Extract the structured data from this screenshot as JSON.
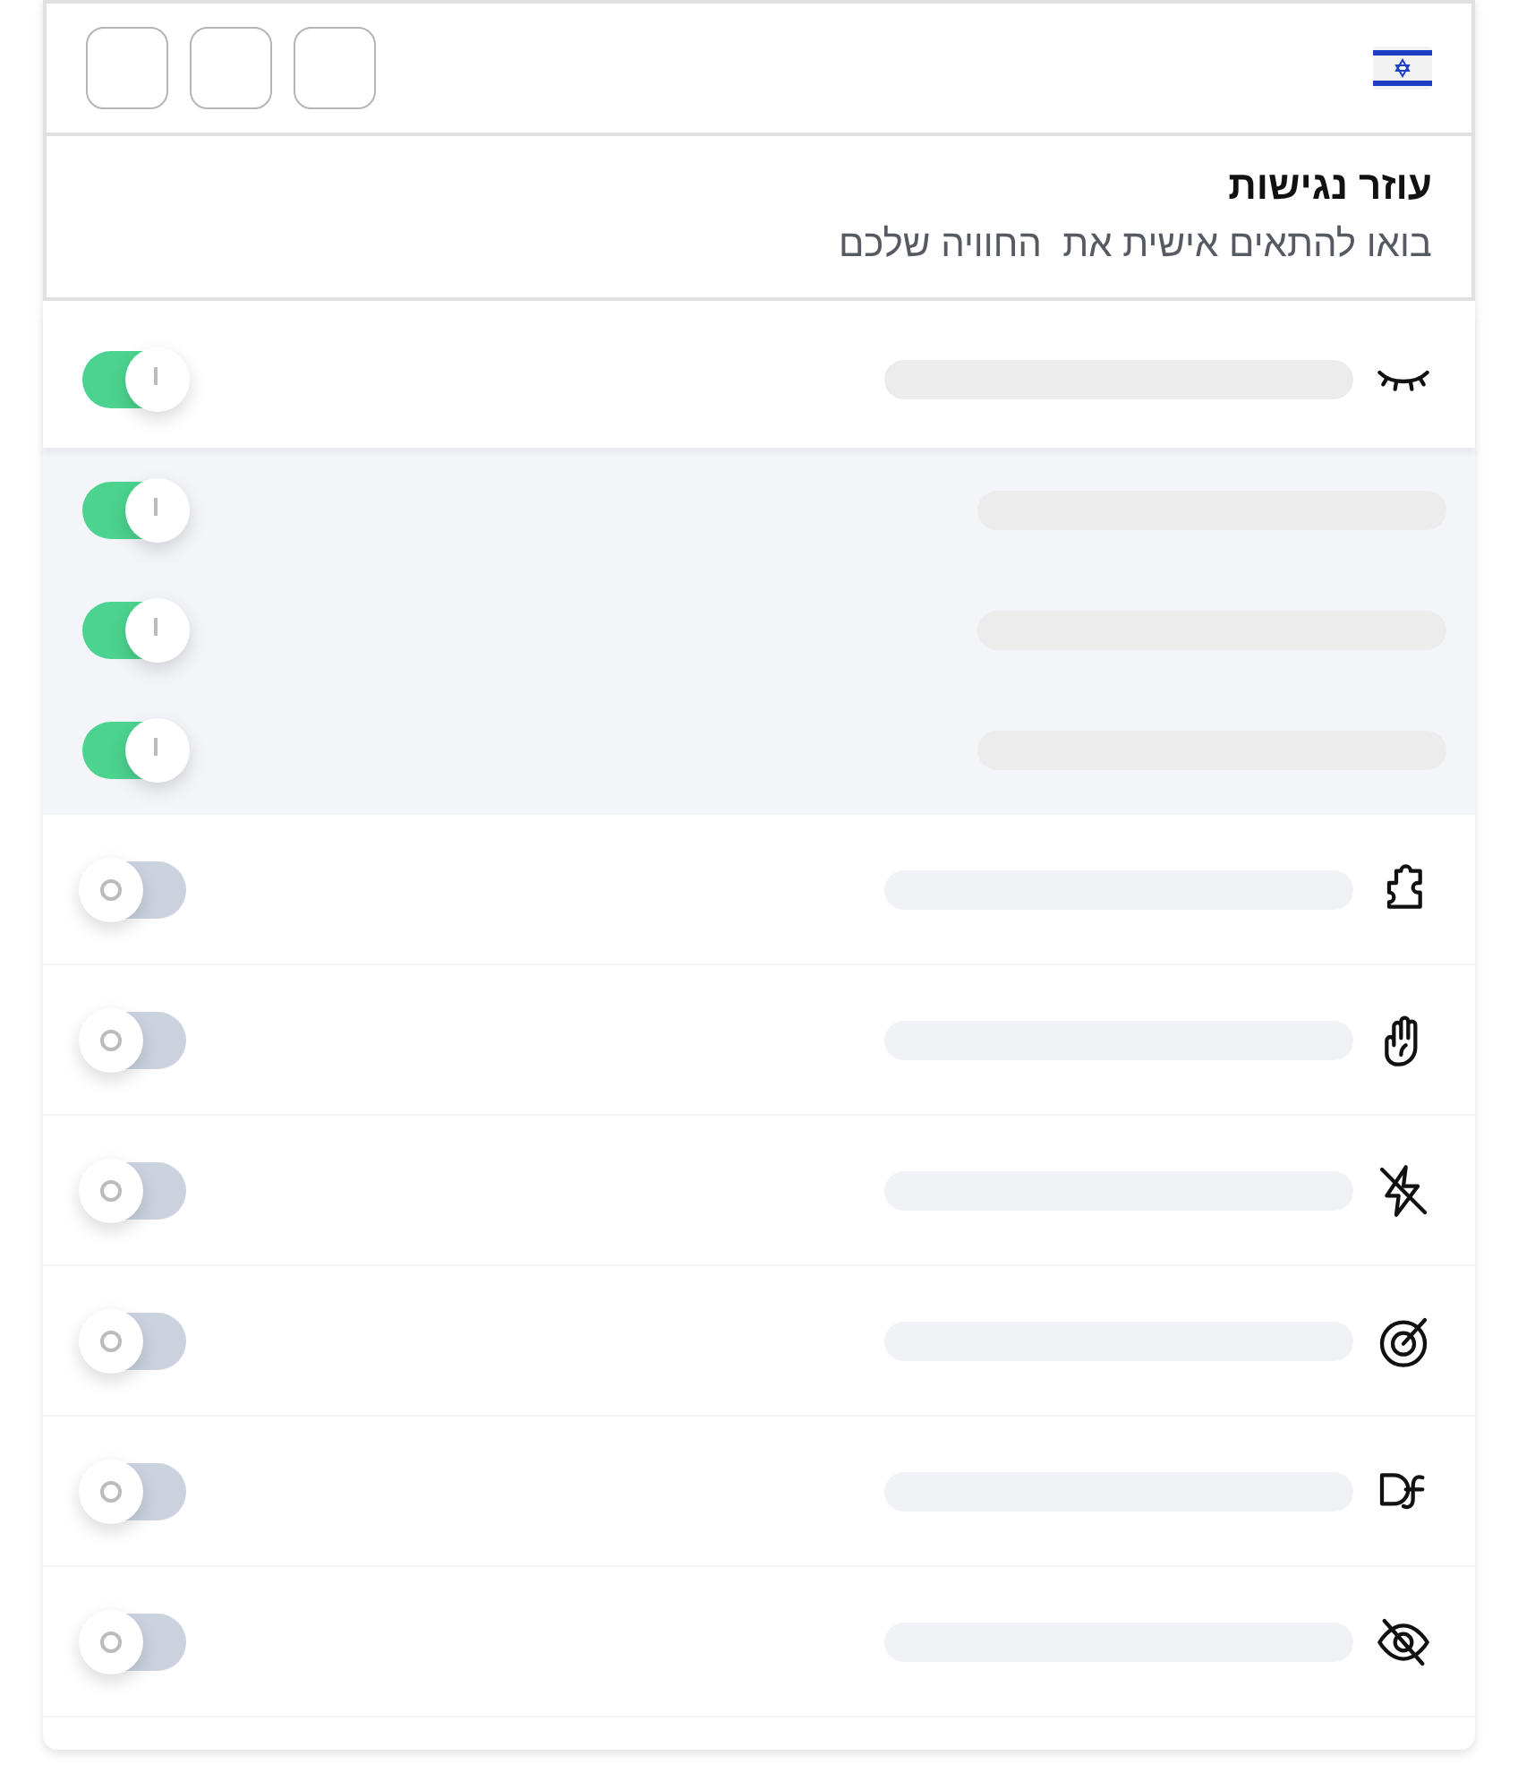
{
  "header": {
    "buttons": [
      {
        "kind": "blank"
      },
      {
        "kind": "blank"
      },
      {
        "kind": "blank"
      }
    ]
  },
  "title": "עוזר נגישות",
  "subtitle": "בואו להתאים אישית את  החוויה שלכם",
  "features": [
    {
      "on": true,
      "children": [
        {
          "on": true
        },
        {
          "on": true
        },
        {
          "on": true
        }
      ]
    },
    {
      "on": false
    },
    {
      "on": false
    },
    {
      "on": false
    },
    {
      "on": false
    },
    {
      "on": false
    },
    {
      "on": false
    }
  ]
}
